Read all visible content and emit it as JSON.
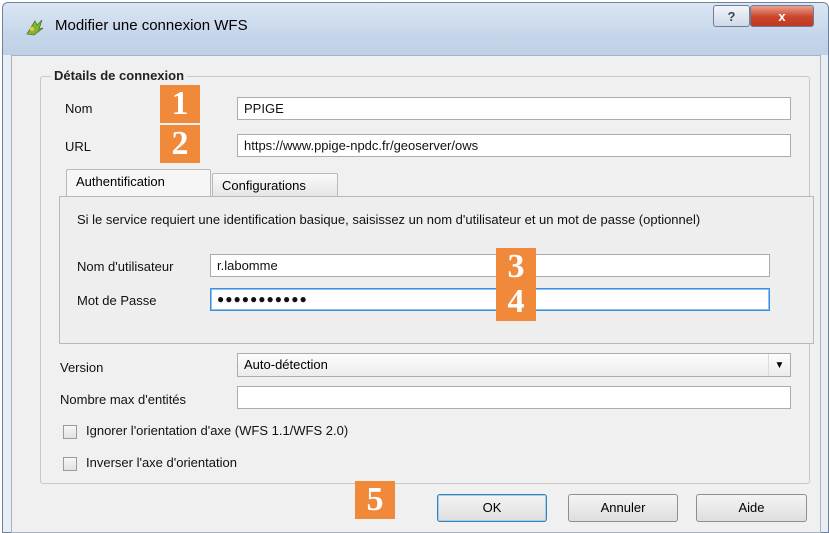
{
  "window": {
    "title": "Modifier une connexion WFS",
    "help_label": "?",
    "close_label": "x"
  },
  "group": {
    "title": "Détails de connexion"
  },
  "fields": {
    "name_label": "Nom",
    "name_value": "PPIGE",
    "url_label": "URL",
    "url_value": "https://www.ppige-npdc.fr/geoserver/ows"
  },
  "tabs": [
    {
      "label": "Authentification",
      "active": true
    },
    {
      "label": "Configurations",
      "active": false
    }
  ],
  "auth": {
    "description": "Si le service requiert une identification basique, saisissez un nom d'utilisateur et un mot de passe (optionnel)",
    "username_label": "Nom d'utilisateur",
    "username_value": "r.labomme",
    "password_label": "Mot de Passe",
    "password_value": "●●●●●●●●●●●"
  },
  "version": {
    "label": "Version",
    "selected": "Auto-détection"
  },
  "max_features": {
    "label": "Nombre max d'entités",
    "value": ""
  },
  "checkboxes": [
    {
      "label": "Ignorer l'orientation d'axe (WFS 1.1/WFS 2.0)",
      "checked": false
    },
    {
      "label": "Inverser l'axe d'orientation",
      "checked": false
    }
  ],
  "buttons": {
    "ok": "OK",
    "cancel": "Annuler",
    "help": "Aide"
  },
  "annotations": [
    "1",
    "2",
    "3",
    "4",
    "5"
  ],
  "colors": {
    "badge": "#f08a3a",
    "close": "#c8452b"
  }
}
